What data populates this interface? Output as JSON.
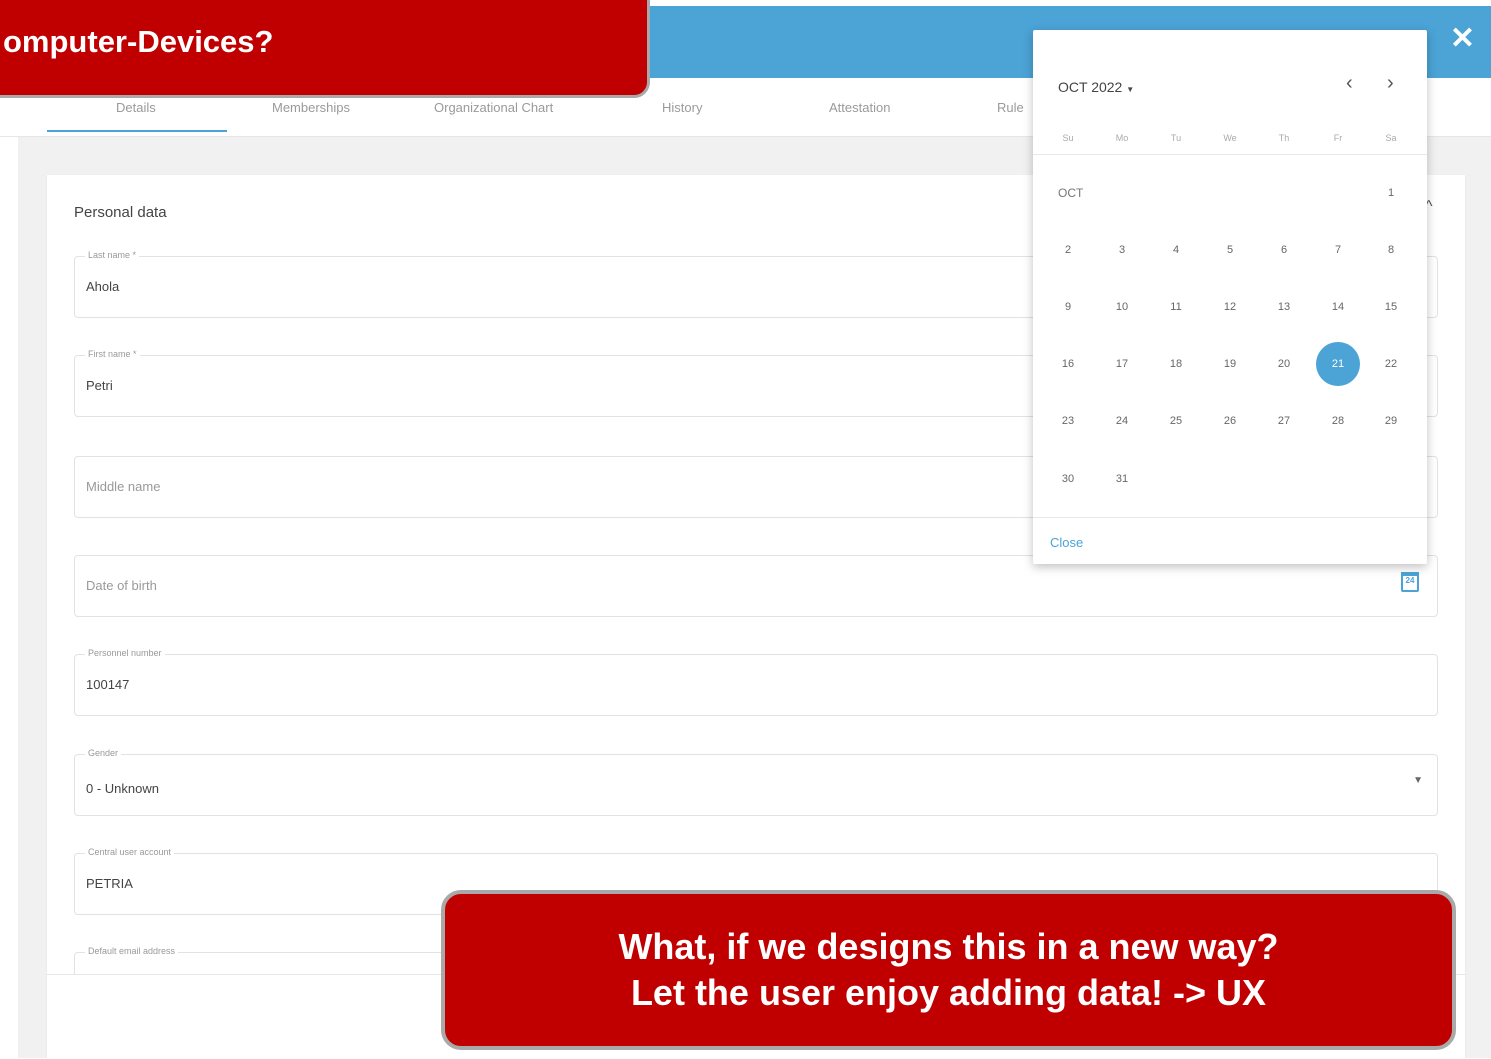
{
  "header": {
    "close_label": "✕",
    "callout_text": "omputer-Devices?"
  },
  "tabs": [
    "Details",
    "Memberships",
    "Organizational Chart",
    "History",
    "Attestation",
    "Rule"
  ],
  "section": {
    "title": "Personal data",
    "chevron": "^"
  },
  "fields": {
    "last_name": {
      "label": "Last name *",
      "value": "Ahola"
    },
    "first_name": {
      "label": "First name *",
      "value": "Petri"
    },
    "middle_name": {
      "placeholder": "Middle name"
    },
    "date_of_birth": {
      "placeholder": "Date of birth",
      "calendar_day": "24"
    },
    "personnel_number": {
      "label": "Personnel number",
      "value": "100147"
    },
    "gender": {
      "label": "Gender",
      "value": "0 - Unknown"
    },
    "central_user_account": {
      "label": "Central user account",
      "value": "PETRIA"
    },
    "default_email": {
      "label": "Default email address"
    }
  },
  "datepicker": {
    "month_year": "OCT 2022",
    "month_label": "OCT",
    "weekdays": [
      "Su",
      "Mo",
      "Tu",
      "We",
      "Th",
      "Fr",
      "Sa"
    ],
    "weeks": [
      [
        "",
        "",
        "",
        "",
        "",
        "",
        "1"
      ],
      [
        "2",
        "3",
        "4",
        "5",
        "6",
        "7",
        "8"
      ],
      [
        "9",
        "10",
        "11",
        "12",
        "13",
        "14",
        "15"
      ],
      [
        "16",
        "17",
        "18",
        "19",
        "20",
        "21",
        "22"
      ],
      [
        "23",
        "24",
        "25",
        "26",
        "27",
        "28",
        "29"
      ],
      [
        "30",
        "31",
        "",
        "",
        "",
        "",
        ""
      ]
    ],
    "selected": "21",
    "close_label": "Close"
  },
  "callout": {
    "line1": "What, if we designs this in a new way?",
    "line2": "Let the user enjoy adding data! -> UX"
  },
  "colors": {
    "accent": "#4ba3d6",
    "callout": "#c00000"
  }
}
